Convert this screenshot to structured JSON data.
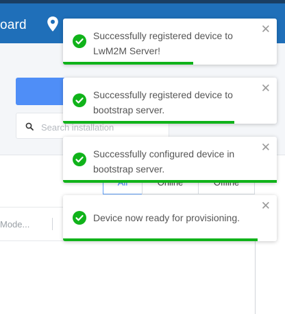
{
  "header": {
    "title_fragment": "oard",
    "location_icon": "map-pin-icon",
    "background": "#1f6fb9"
  },
  "toolbar": {
    "primary_button_color": "#4f8ef7",
    "search_placeholder": "Search installation"
  },
  "table": {
    "filter_tabs": [
      {
        "label": "All",
        "active": true
      },
      {
        "label": "Online",
        "active": false
      },
      {
        "label": "Offline",
        "active": false
      }
    ],
    "column_header": "Mode..."
  },
  "notifications": [
    {
      "message": "Successfully registered device to LwM2M Server!",
      "progress": 0.61,
      "icon": "success-check-icon"
    },
    {
      "message": "Successfully registered device to bootstrap server.",
      "progress": 0.8,
      "icon": "success-check-icon"
    },
    {
      "message": "Successfully configured device in bootstrap server.",
      "progress": 1.0,
      "icon": "success-check-icon"
    },
    {
      "message": "Device now ready for provisioning.",
      "progress": 0.91,
      "icon": "success-check-icon"
    }
  ],
  "colors": {
    "success": "#10b31a",
    "accent": "#3b82f6"
  }
}
